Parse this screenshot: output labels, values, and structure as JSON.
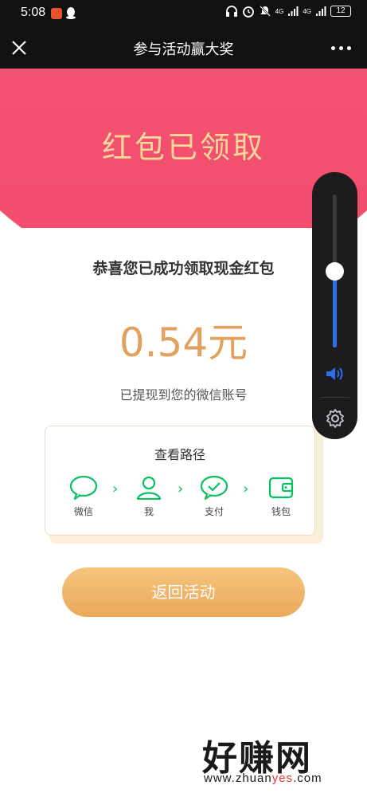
{
  "status_bar": {
    "time": "5:08",
    "battery": "12",
    "net_label_1": "4G",
    "net_label_2": "4G"
  },
  "title_bar": {
    "title": "参与活动赢大奖"
  },
  "header": {
    "title": "红包已领取",
    "color_start": "#f0657a",
    "color_end": "#f44b6c"
  },
  "main": {
    "congrats": "恭喜您已成功领取现金红包",
    "amount": "0.54元",
    "note": "已提现到您的微信账号",
    "path": {
      "title": "查看路径",
      "steps": [
        {
          "label": "微信",
          "icon": "wechat-icon"
        },
        {
          "label": "我",
          "icon": "user-icon"
        },
        {
          "label": "支付",
          "icon": "pay-check-icon"
        },
        {
          "label": "钱包",
          "icon": "wallet-icon"
        }
      ]
    },
    "back_button": "返回活动"
  },
  "volume": {
    "level": 0.5,
    "accent": "#2f6fe6"
  },
  "watermark": {
    "main": "好赚网",
    "sub_prefix": "www.zhuan",
    "sub_highlight": "yes",
    "sub_suffix": ".com"
  },
  "colors": {
    "wechat_green": "#07c160",
    "amount": "#e2a25d",
    "button": "#eaa95a"
  }
}
